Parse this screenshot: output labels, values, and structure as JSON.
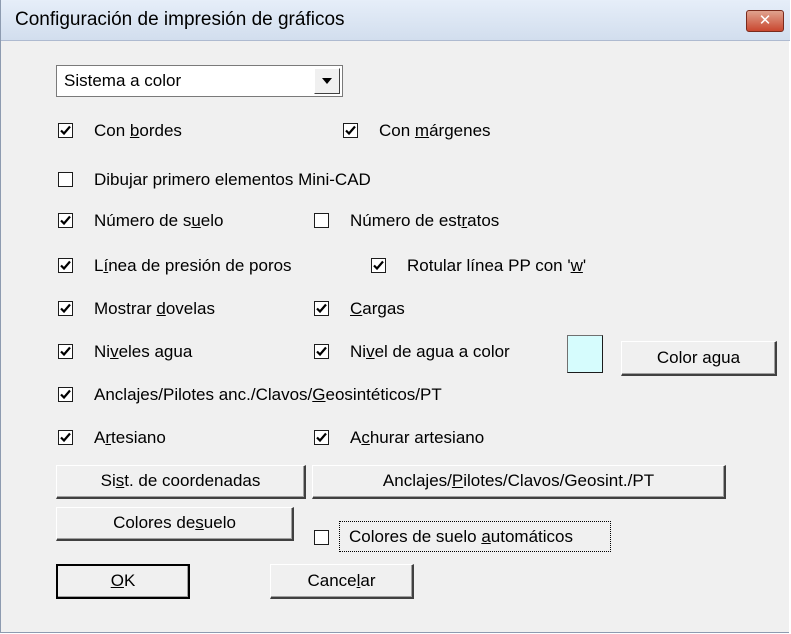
{
  "window": {
    "title": "Configuración de impresión de gráficos",
    "close_glyph": "✕"
  },
  "system_select": {
    "value": "Sistema a color"
  },
  "options": {
    "con_bordes": {
      "pre": "Con ",
      "mnemonic": "b",
      "post": "ordes",
      "checked": true
    },
    "con_margenes": {
      "pre": "Con ",
      "mnemonic": "m",
      "post": "árgenes",
      "checked": true
    },
    "dibujar_minicad": {
      "label": "Dibujar primero elementos Mini-CAD",
      "checked": false
    },
    "numero_suelo": {
      "pre": "Número de s",
      "mnemonic": "u",
      "post": "elo",
      "checked": true
    },
    "numero_estratos": {
      "pre": "Número de est",
      "mnemonic": "r",
      "post": "atos",
      "checked": false
    },
    "linea_presion": {
      "pre": "L",
      "mnemonic": "í",
      "post": "nea de presión de poros",
      "checked": true
    },
    "rotular_linea": {
      "pre": "Rotular línea PP con '",
      "mnemonic": "w",
      "post": "'",
      "checked": true
    },
    "mostrar_dovelas": {
      "pre": "Mostrar ",
      "mnemonic": "d",
      "post": "ovelas",
      "checked": true
    },
    "cargas": {
      "pre": "",
      "mnemonic": "C",
      "post": "argas",
      "checked": true
    },
    "niveles_agua": {
      "pre": "Ni",
      "mnemonic": "v",
      "post": "eles agua",
      "checked": true
    },
    "nivel_agua_color": {
      "pre": "Ni",
      "mnemonic": "v",
      "post": "el de agua a color",
      "checked": true
    },
    "anclajes": {
      "pre": "Anclajes/Pilotes anc./Clavos/",
      "mnemonic": "G",
      "post": "eosintéticos/PT",
      "checked": true
    },
    "artesiano": {
      "pre": "A",
      "mnemonic": "r",
      "post": "tesiano",
      "checked": true
    },
    "achurar_artesiano": {
      "pre": "A",
      "mnemonic": "c",
      "post": "hurar artesiano",
      "checked": true
    },
    "colores_suelo_auto": {
      "pre": "Colores de suelo ",
      "mnemonic": "a",
      "post": "utomáticos",
      "checked": false
    }
  },
  "buttons": {
    "color_agua": {
      "label": "Color agua"
    },
    "sist_coordenadas": {
      "pre": "Si",
      "mnemonic": "s",
      "post": "t. de coordenadas"
    },
    "anclajes_btn": {
      "pre": "Anclajes/",
      "mnemonic": "P",
      "post": "ilotes/Clavos/Geosint./PT"
    },
    "colores_suelo": {
      "pre": "Colores de ",
      "mnemonic": "s",
      "post": "uelo"
    },
    "ok": {
      "pre": "",
      "mnemonic": "O",
      "post": "K"
    },
    "cancelar": {
      "pre": "Cance",
      "mnemonic": "l",
      "post": "ar"
    }
  },
  "colors": {
    "water_swatch": "#d6fcfd",
    "dialog_bg": "#f0f0f0",
    "close_red": "#c9472f"
  },
  "icons": {
    "check": "checkmark-icon",
    "dropdown": "chevron-down-icon",
    "close": "close-icon"
  }
}
